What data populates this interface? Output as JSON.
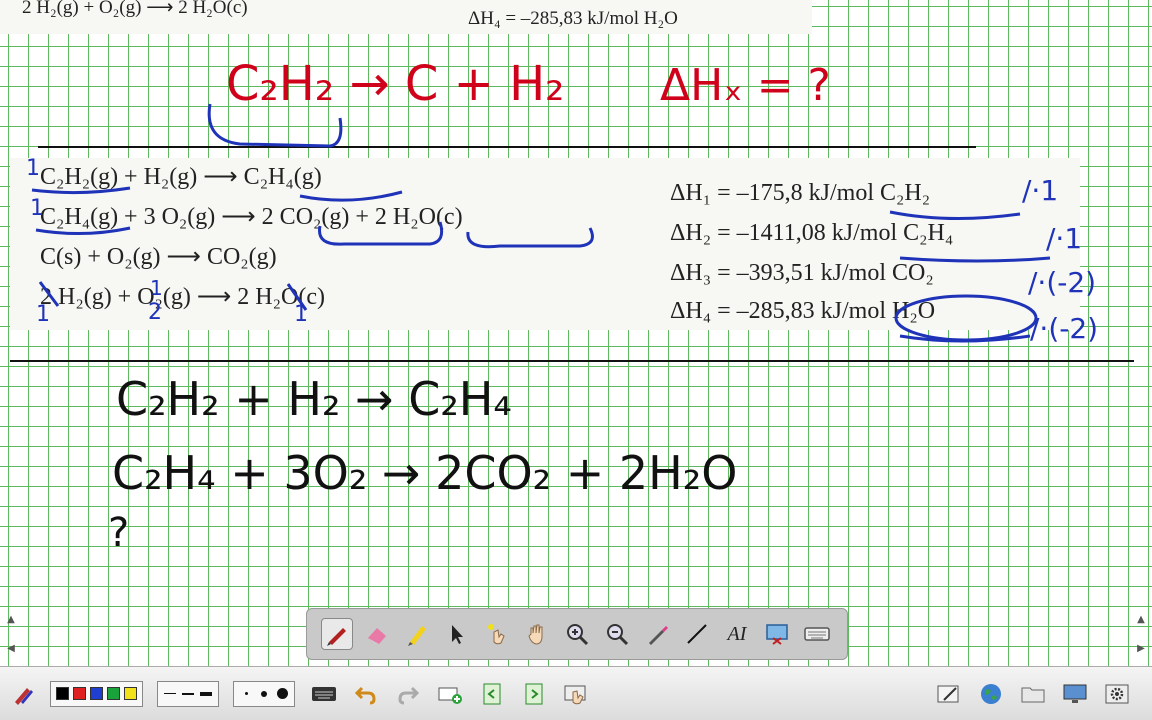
{
  "scan_top": {
    "reaction": "2 H₂(g) + O₂(g) ⟶ 2 H₂O(c)",
    "enthalpy": "ΔH₄ = –285,83 kJ/mol H₂O"
  },
  "scan_main": {
    "reactions": [
      "C₂H₂(g) + H₂(g) ⟶ C₂H₄(g)",
      "C₂H₄(g) + 3 O₂(g) ⟶ 2 CO₂(g) + 2 H₂O(c)",
      "C(s) + O₂(g) ⟶ CO₂(g)",
      "2 H₂(g) + O₂(g) ⟶ 2 H₂O(c)"
    ],
    "enthalpies": [
      "ΔH₁ = –175,8 kJ/mol C₂H₂",
      "ΔH₂ = –1411,08 kJ/mol C₂H₄",
      "ΔH₃ = –393,51 kJ/mol CO₂",
      "ΔH₄ = –285,83 kJ/mol H₂O"
    ]
  },
  "handwriting": {
    "target_reaction": "C₂H₂ → C + H₂",
    "target_enthalpy": "ΔHₓ = ?",
    "multipliers": [
      "/·1",
      "/·1",
      "/·(-2)",
      "/·(-2)"
    ],
    "coef_marks": [
      "1",
      "1",
      "1",
      "1",
      "2",
      "1"
    ],
    "work_lines": [
      "C₂H₂ + H₂ → C₂H₄",
      "C₂H₄ + 3O₂ → 2CO₂ + 2H₂O",
      "?"
    ]
  },
  "floating_toolbar": {
    "tools": [
      "pen-icon",
      "eraser-icon",
      "highlighter-icon",
      "select-arrow-icon",
      "laser-pointer-icon",
      "pan-hand-icon",
      "zoom-in-icon",
      "zoom-out-icon",
      "magic-pen-icon",
      "line-icon",
      "text-tool-icon",
      "screen-capture-icon",
      "keyboard-icon"
    ],
    "text_tool_label": "AI",
    "active_tool": "pen-icon"
  },
  "bottom_toolbar": {
    "colors": [
      "#000000",
      "#e02020",
      "#1f3fd0",
      "#1aa33a",
      "#f2e01a"
    ],
    "line_widths": [
      "thin",
      "medium",
      "thick"
    ],
    "point_sizes": [
      "small",
      "medium",
      "large"
    ]
  }
}
